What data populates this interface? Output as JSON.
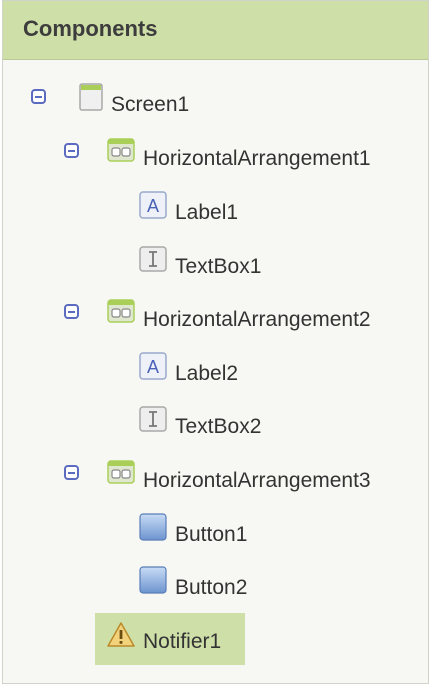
{
  "panel": {
    "title": "Components"
  },
  "tree": {
    "screen1": {
      "label": "Screen1",
      "icon": "screen-icon"
    },
    "ha1": {
      "label": "HorizontalArrangement1",
      "icon": "horizontal-arrangement-icon"
    },
    "label1": {
      "label": "Label1",
      "icon": "label-icon"
    },
    "textbox1": {
      "label": "TextBox1",
      "icon": "textbox-icon"
    },
    "ha2": {
      "label": "HorizontalArrangement2",
      "icon": "horizontal-arrangement-icon"
    },
    "label2": {
      "label": "Label2",
      "icon": "label-icon"
    },
    "textbox2": {
      "label": "TextBox2",
      "icon": "textbox-icon"
    },
    "ha3": {
      "label": "HorizontalArrangement3",
      "icon": "horizontal-arrangement-icon"
    },
    "button1": {
      "label": "Button1",
      "icon": "button-icon"
    },
    "button2": {
      "label": "Button2",
      "icon": "button-icon"
    },
    "notifier1": {
      "label": "Notifier1",
      "icon": "warning-icon",
      "selected": true
    }
  },
  "colors": {
    "header_bg": "#cfdfa8",
    "selected_bg": "#cfdfa8",
    "toggle": "#5b6bbf",
    "panel_bg": "#f7f8f3"
  }
}
